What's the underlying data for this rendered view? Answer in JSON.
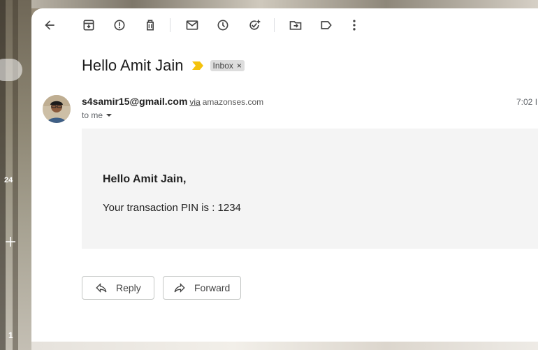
{
  "toolbar": {
    "icons": [
      "back-arrow-icon",
      "archive-icon",
      "report-spam-icon",
      "delete-icon",
      "mark-unread-icon",
      "snooze-icon",
      "add-task-icon",
      "move-to-icon",
      "label-icon",
      "more-vert-icon"
    ]
  },
  "email": {
    "subject": "Hello Amit Jain",
    "label_chip": "Inbox",
    "label_chip_close": "×",
    "sender_email": "s4samir15@gmail.com",
    "via_text": "via",
    "via_domain": "amazonses.com",
    "time": "7:02 I",
    "recipient": "to me",
    "body_greeting": "Hello Amit Jain,",
    "body_text": "Your transaction PIN is : 1234"
  },
  "actions": {
    "reply_label": "Reply",
    "forward_label": "Forward"
  },
  "left_rail": {
    "badge_count": "24",
    "bottom_number": "1"
  },
  "colors": {
    "important_marker": "#f4c20d",
    "chip_bg": "#dddddd",
    "body_bg": "#f4f4f4"
  }
}
